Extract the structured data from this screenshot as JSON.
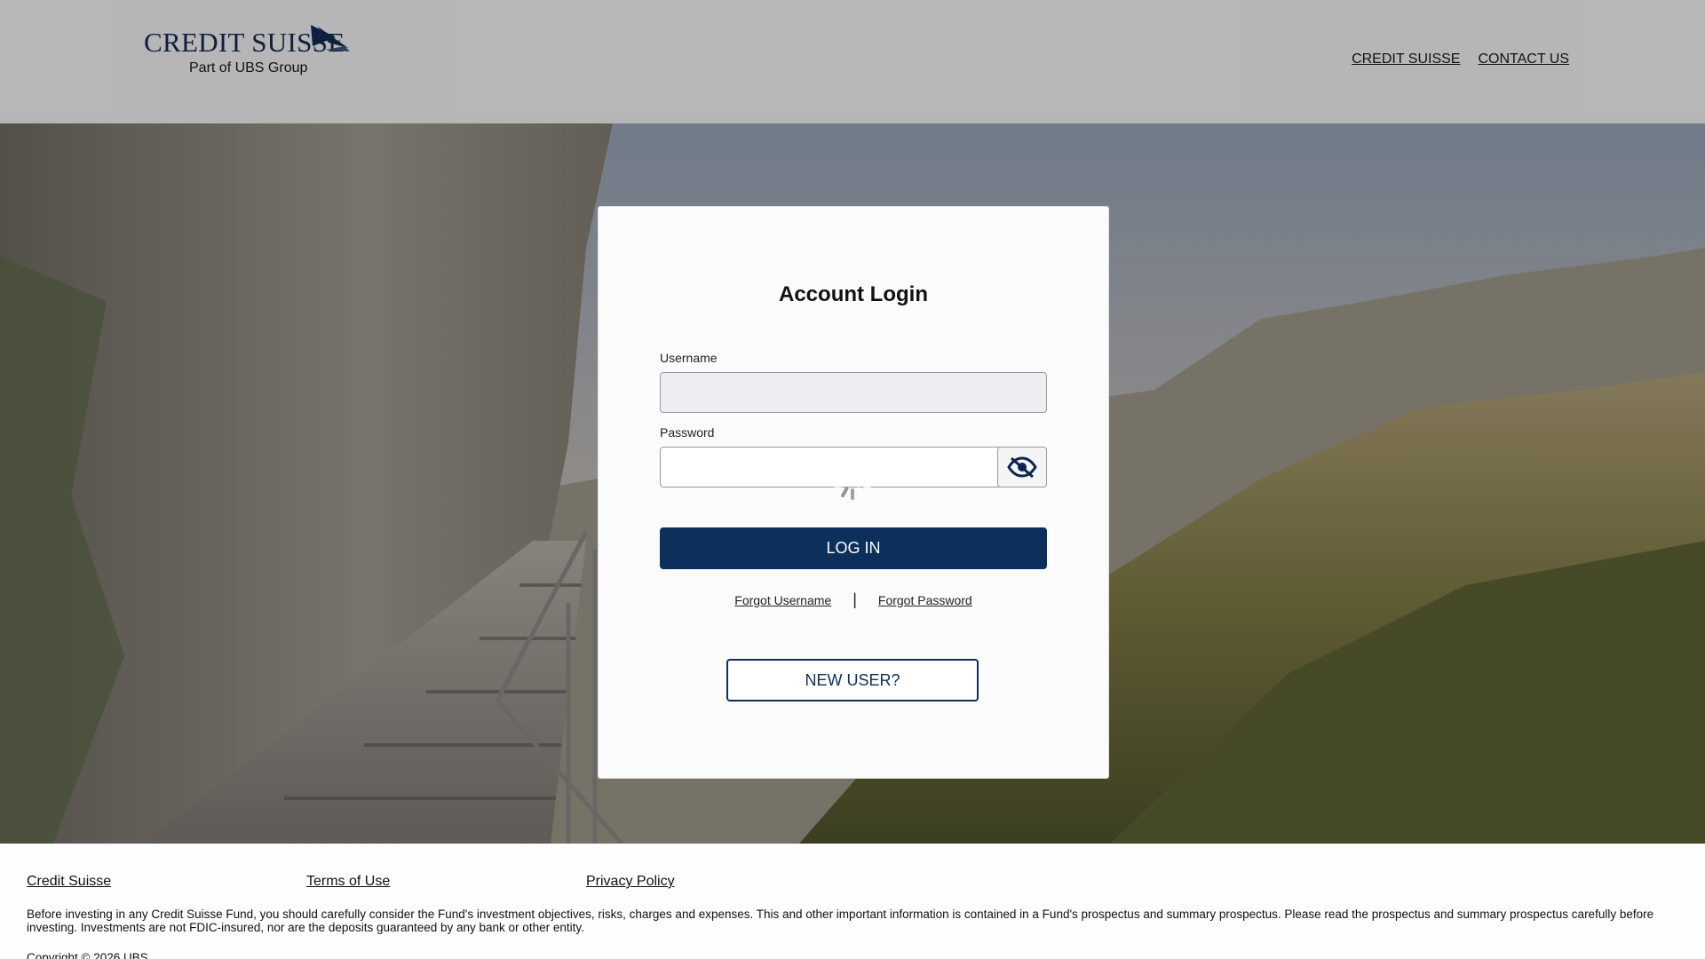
{
  "header": {
    "logo_name": "CREDIT SUISSE",
    "logo_subtitle": "Part of UBS Group",
    "nav": [
      "CREDIT SUISSE",
      "CONTACT US"
    ]
  },
  "login": {
    "title": "Account Login",
    "username_label": "Username",
    "username_value": "",
    "password_label": "Password",
    "password_value": "",
    "password_toggle_icon": "eye-slash-icon",
    "login_button": "LOG IN",
    "forgot_username": "Forgot Username",
    "separator": "|",
    "forgot_password": "Forgot Password",
    "new_user_button": "NEW USER?",
    "loading": true
  },
  "footer": {
    "links": [
      "Credit Suisse",
      "Terms of Use",
      "Privacy Policy"
    ],
    "disclaimer": "Before investing in any Credit Suisse Fund, you should carefully consider the Fund's investment objectives, risks, charges and expenses. This and other important information is contained in a Fund's prospectus and summary prospectus. Please read the prospectus and summary prospectus carefully before investing. Investments are not FDIC-insured, nor are the deposits guaranteed by any bank or other entity.",
    "copyright": "Copyright © 2026 UBS"
  },
  "colors": {
    "brand_navy": "#0c2452",
    "button_navy": "#0c2f5c"
  }
}
